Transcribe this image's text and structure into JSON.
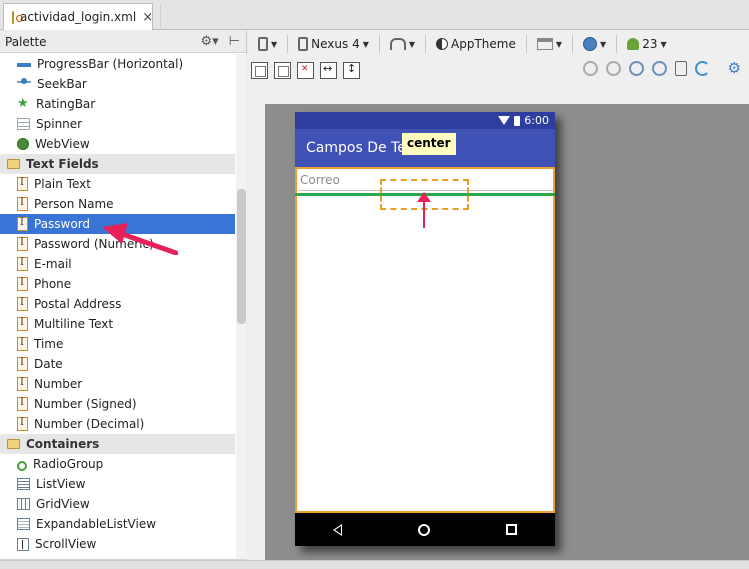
{
  "tab": {
    "label": "actividad_login.xml",
    "close": "×"
  },
  "palette": {
    "title": "Palette",
    "items": [
      {
        "label": "ProgressBar (Horizontal)",
        "type": "item",
        "icon": "progressbar-icon"
      },
      {
        "label": "SeekBar",
        "type": "item",
        "icon": "seekbar-icon"
      },
      {
        "label": "RatingBar",
        "type": "item",
        "icon": "ratingbar-icon"
      },
      {
        "label": "Spinner",
        "type": "item",
        "icon": "spinner-icon"
      },
      {
        "label": "WebView",
        "type": "item",
        "icon": "webview-icon"
      },
      {
        "label": "Text Fields",
        "type": "category",
        "icon": "folder-icon"
      },
      {
        "label": "Plain Text",
        "type": "item",
        "icon": "textfield-icon"
      },
      {
        "label": "Person Name",
        "type": "item",
        "icon": "textfield-icon"
      },
      {
        "label": "Password",
        "type": "item",
        "icon": "textfield-icon",
        "selected": true
      },
      {
        "label": "Password (Numeric)",
        "type": "item",
        "icon": "textfield-icon"
      },
      {
        "label": "E-mail",
        "type": "item",
        "icon": "textfield-icon"
      },
      {
        "label": "Phone",
        "type": "item",
        "icon": "textfield-icon"
      },
      {
        "label": "Postal Address",
        "type": "item",
        "icon": "textfield-icon"
      },
      {
        "label": "Multiline Text",
        "type": "item",
        "icon": "textfield-icon"
      },
      {
        "label": "Time",
        "type": "item",
        "icon": "textfield-icon"
      },
      {
        "label": "Date",
        "type": "item",
        "icon": "textfield-icon"
      },
      {
        "label": "Number",
        "type": "item",
        "icon": "textfield-icon"
      },
      {
        "label": "Number (Signed)",
        "type": "item",
        "icon": "textfield-icon"
      },
      {
        "label": "Number (Decimal)",
        "type": "item",
        "icon": "textfield-icon"
      },
      {
        "label": "Containers",
        "type": "category",
        "icon": "folder-icon"
      },
      {
        "label": "RadioGroup",
        "type": "item",
        "icon": "radiogroup-icon"
      },
      {
        "label": "ListView",
        "type": "item",
        "icon": "listview-icon"
      },
      {
        "label": "GridView",
        "type": "item",
        "icon": "gridview-icon"
      },
      {
        "label": "ExpandableListView",
        "type": "item",
        "icon": "expandablelistview-icon"
      },
      {
        "label": "ScrollView",
        "type": "item",
        "icon": "scrollview-icon"
      }
    ]
  },
  "toolbar": {
    "device": "Nexus 4",
    "theme": "AppTheme",
    "api": "23"
  },
  "phone": {
    "time": "6:00",
    "app_title": "Campos De Tex",
    "tooltip": "center",
    "edit_hint": "Correo"
  },
  "colors": {
    "selection": "#3875d7",
    "action_bar": "#3f51b5",
    "status_bar": "#2f3e9e",
    "accent_pink": "#e8205a",
    "drop_outline": "#e8a020",
    "guide_green": "#2aa84a"
  }
}
